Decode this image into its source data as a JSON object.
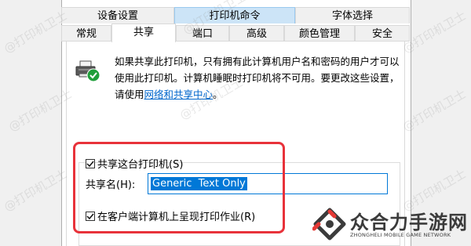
{
  "tabs_top": [
    {
      "label": "设备设置",
      "highlight": false
    },
    {
      "label": "打印机命令",
      "highlight": true
    },
    {
      "label": "字体选择",
      "highlight": false
    }
  ],
  "tabs_bottom": [
    {
      "label": "常规",
      "active": false
    },
    {
      "label": "共享",
      "active": true
    },
    {
      "label": "端口",
      "active": false
    },
    {
      "label": "高级",
      "active": false
    },
    {
      "label": "颜色管理",
      "active": false
    },
    {
      "label": "安全",
      "active": false
    }
  ],
  "info": {
    "text_before_link": "如果共享此打印机，只有拥有此计算机用户名和密码的用户才可以使用此打印机。计算机睡眠时打印机将不可用。要更改这些设置，请使用",
    "link": "网络和共享中心",
    "text_after_link": "。"
  },
  "share_checkbox": {
    "label": "共享这台打印机(S)",
    "checked": true
  },
  "share_name": {
    "label": "共享名(H):",
    "value": "Generic  Text Only"
  },
  "render_checkbox": {
    "label": "在客户端计算机上呈现打印作业(R)",
    "checked": true
  },
  "watermark": "@打印机卫士",
  "brand": {
    "name": "众合力手游网",
    "subtitle": "ZHONGHELI MOBILE GAME NETWORK"
  },
  "colors": {
    "accent": "#0078d7",
    "highlight_box": "#e8323a",
    "link": "#0066cc"
  }
}
